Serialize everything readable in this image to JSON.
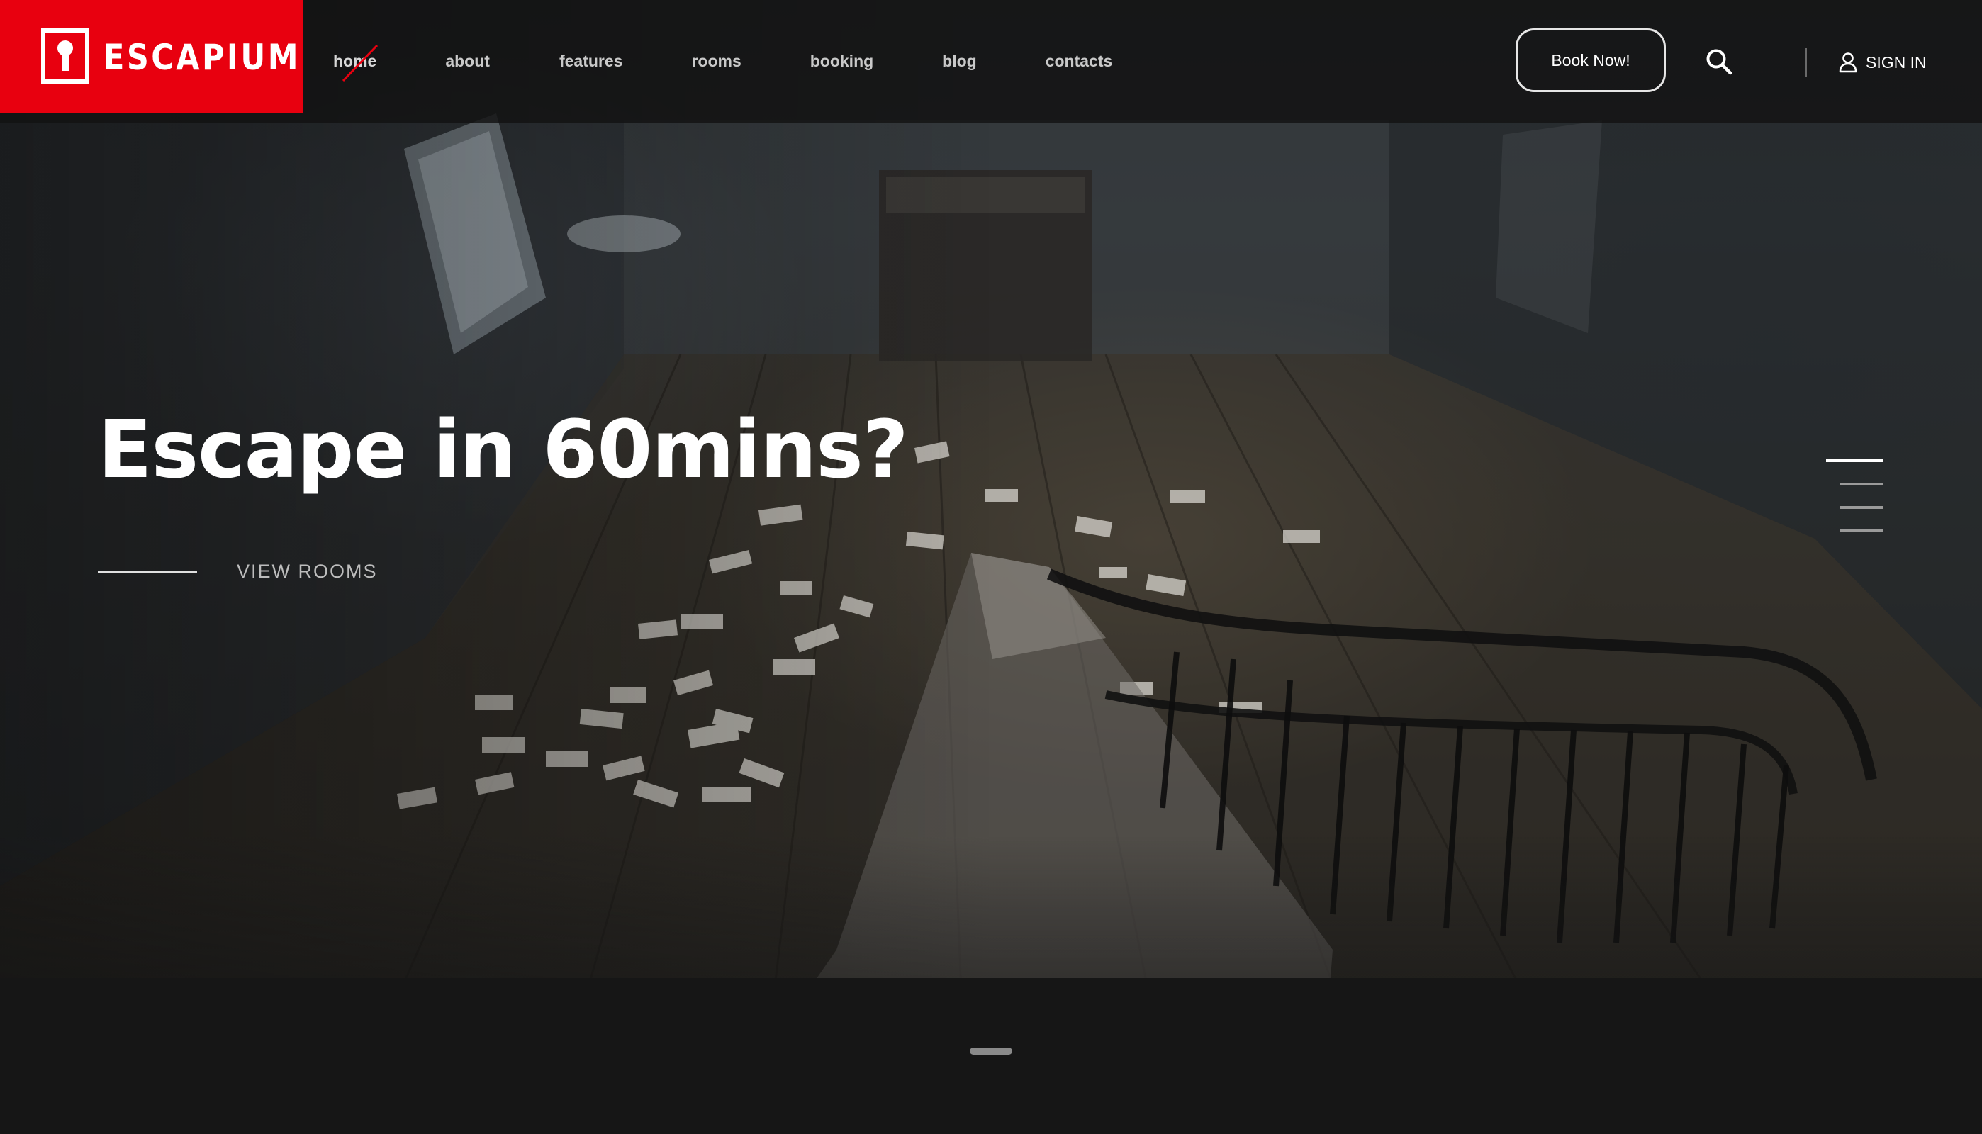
{
  "brand": {
    "name": "ESCAPIUM",
    "logo_icon": "keyhole-icon",
    "accent_color": "#e8000f"
  },
  "nav": {
    "items": [
      {
        "label": "home",
        "active": true
      },
      {
        "label": "about"
      },
      {
        "label": "features"
      },
      {
        "label": "rooms"
      },
      {
        "label": "booking"
      },
      {
        "label": "blog"
      },
      {
        "label": "contacts"
      }
    ]
  },
  "header": {
    "book_label": "Book Now!",
    "search_icon": "search-icon",
    "signin_icon": "user-icon",
    "signin_label": "SIGN IN"
  },
  "hero": {
    "title": "Escape in 60mins?",
    "cta_label": "VIEW ROOMS",
    "slides_count": 4,
    "active_slide": 1
  }
}
